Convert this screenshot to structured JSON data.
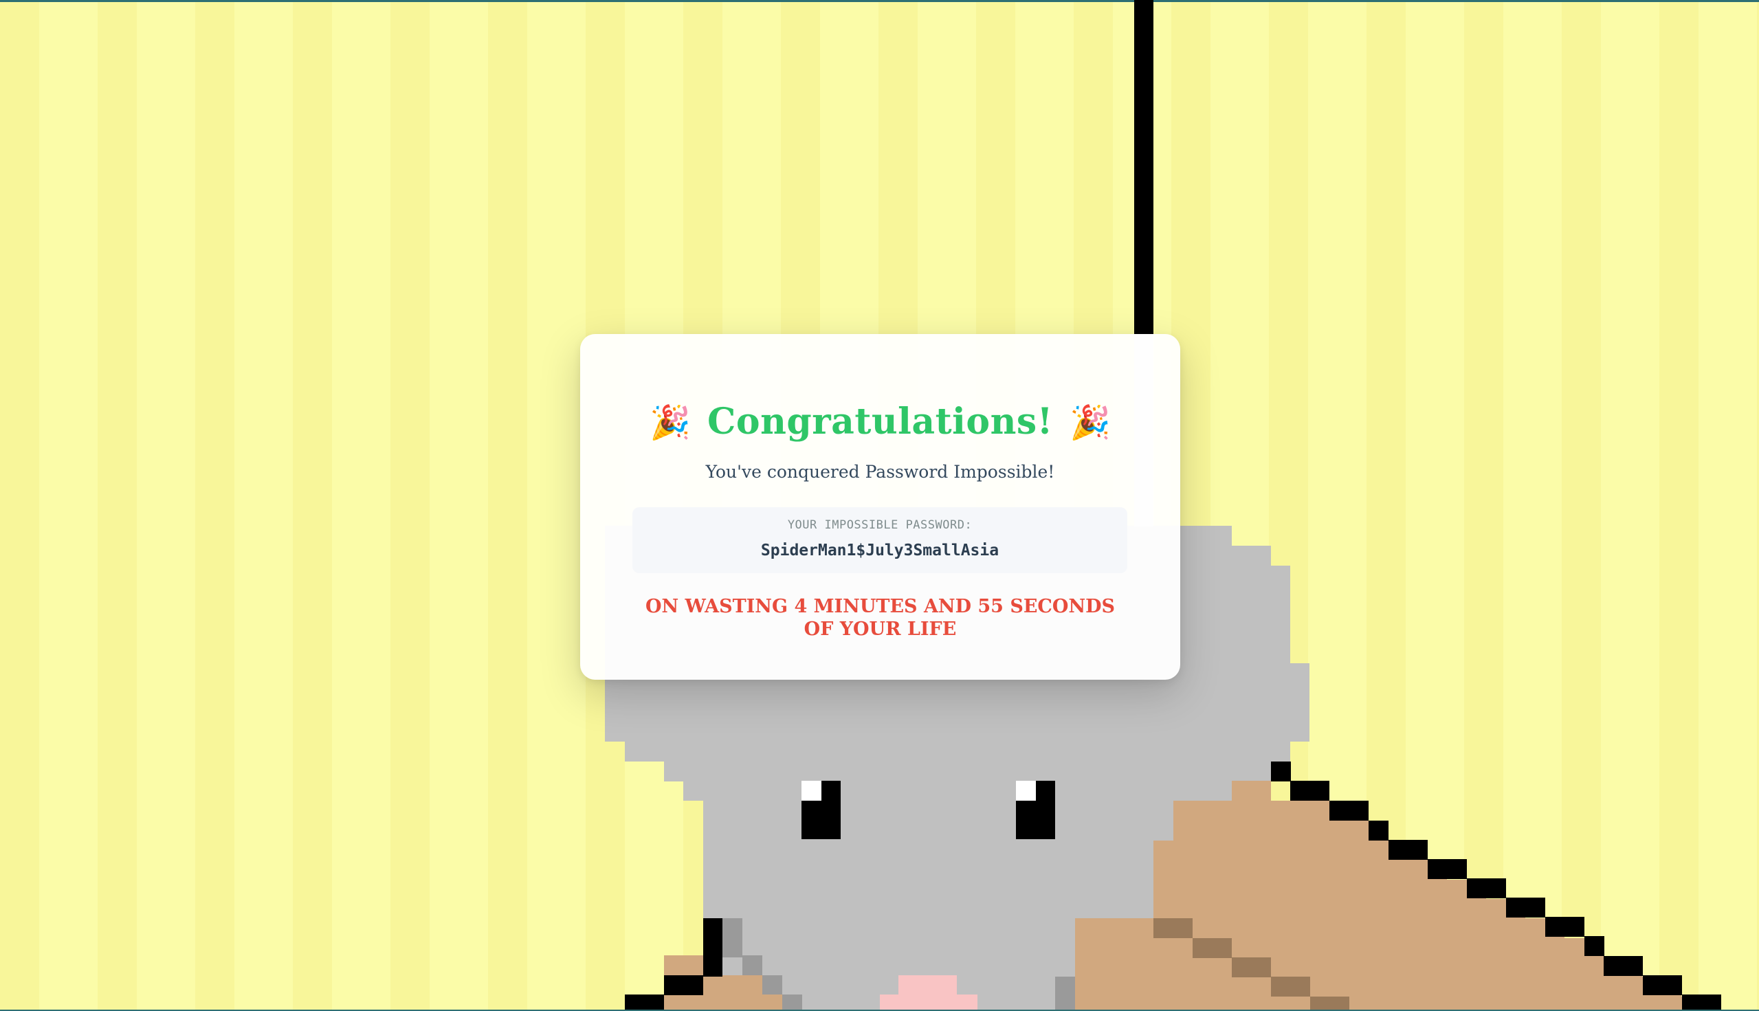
{
  "modal": {
    "title": "Congratulations!",
    "party_icon": "party-popper-icon",
    "party_glyph": "🎉",
    "subtitle": "You've conquered Password Impossible!",
    "password_label": "YOUR IMPOSSIBLE PASSWORD:",
    "password_value": "SpiderMan1$July3SmallAsia",
    "wasted_message": "ON WASTING 4 MINUTES AND 55 SECONDS OF YOUR LIFE"
  },
  "colors": {
    "title": "#2fc667",
    "subtitle": "#34495e",
    "wasted": "#e74c3c",
    "stripe_light": "#fbfca8",
    "stripe_dark": "#f8f69a",
    "mouse_gray": "#c0c0c0",
    "box_tan": "#d1a87f"
  },
  "scene": {
    "character": "pixel-mouse-icon",
    "prop": "cardboard-box-icon"
  }
}
